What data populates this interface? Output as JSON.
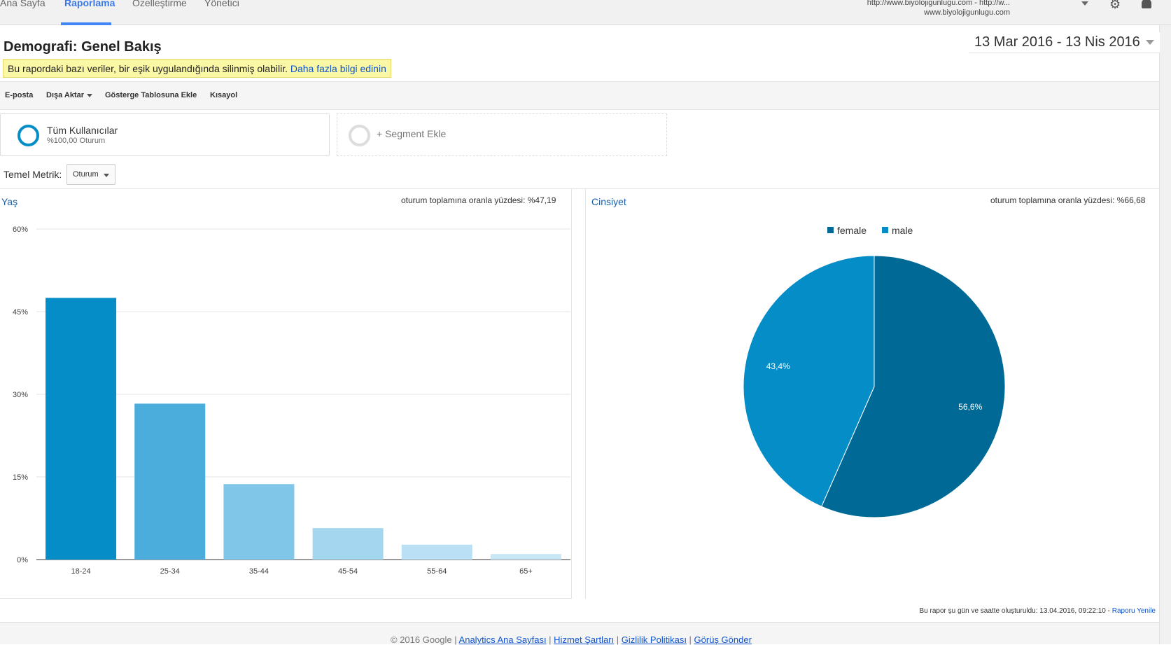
{
  "topnav": {
    "tabs": [
      "Ana Sayfa",
      "Raporlama",
      "Özelleştirme",
      "Yönetici"
    ],
    "active_tab": "Raporlama",
    "account_line1": "http://www.biyolojigunlugu.com - http://w...",
    "account_line2": "www.biyolojigunlugu.com"
  },
  "page": {
    "title": "Demografi: Genel Bakış",
    "warning_text": "Bu rapordaki bazı veriler, bir eşik uygulandığında silinmiş olabilir.",
    "warning_link": "Daha fazla bilgi edinin",
    "date_range": "13 Mar 2016 - 13 Nis 2016"
  },
  "toolbar": {
    "email": "E-posta",
    "export": "Dışa Aktar",
    "dashboard": "Gösterge Tablosuna Ekle",
    "shortcut": "Kısayol"
  },
  "segments": {
    "active_name": "Tüm Kullanıcılar",
    "active_sub": "%100,00 Oturum",
    "add_label": "+ Segment Ekle"
  },
  "metric": {
    "label": "Temel Metrik:",
    "value": "Oturum"
  },
  "age_panel": {
    "title": "Yaş",
    "note": "oturum toplamına oranla yüzdesi: %47,19"
  },
  "gender_panel": {
    "title": "Cinsiyet",
    "note": "oturum toplamına oranla yüzdesi: %66,68"
  },
  "chart_data": [
    {
      "type": "bar",
      "categories": [
        "18-24",
        "25-34",
        "35-44",
        "45-54",
        "55-64",
        "65+"
      ],
      "values": [
        47.5,
        28.3,
        13.7,
        5.7,
        2.7,
        1.0
      ],
      "ylim": [
        0,
        60
      ],
      "yticks": [
        0,
        15,
        30,
        45,
        60
      ],
      "ytick_labels": [
        "0%",
        "15%",
        "30%",
        "45%",
        "60%"
      ],
      "colors": [
        "#058dc7",
        "#4aaddb",
        "#7fc6e8",
        "#a4d6f0",
        "#b9e0f4",
        "#c9e8f7"
      ],
      "grid": true
    },
    {
      "type": "pie",
      "labels": [
        "female",
        "male"
      ],
      "values": [
        56.6,
        43.4
      ],
      "value_labels": [
        "56,6%",
        "43,4%"
      ],
      "colors": [
        "#006996",
        "#058dc7"
      ],
      "legend": "top"
    }
  ],
  "footer": {
    "generated": "Bu rapor şu gün ve saatte oluşturuldu: 13.04.2016, 09:22:10 -",
    "refresh_link": "Raporu Yenile",
    "copyright": "© 2016 Google |",
    "links": [
      "Analytics Ana Sayfası",
      "Hizmet Şartları",
      "Gizlilik Politikası",
      "Görüş Gönder"
    ]
  }
}
